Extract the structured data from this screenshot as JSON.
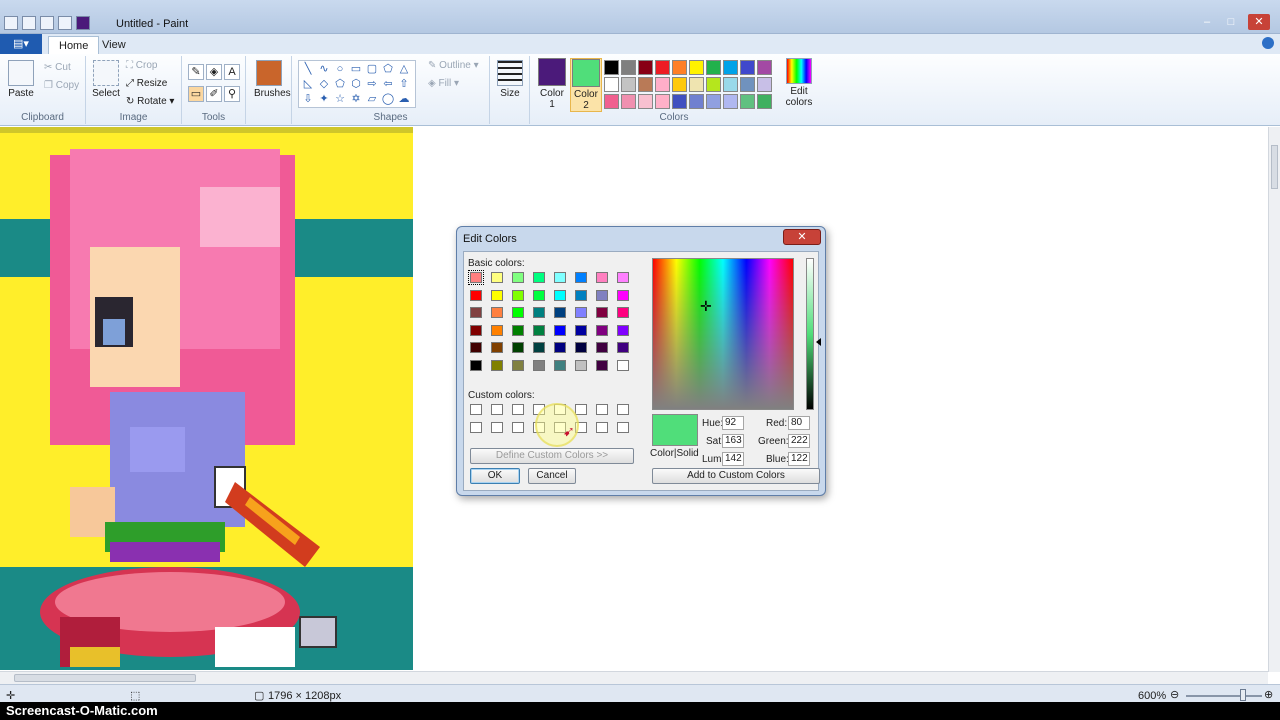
{
  "window": {
    "title": "Untitled - Paint"
  },
  "ribbon_tabs": {
    "file": "▤▾",
    "home": "Home",
    "view": "View"
  },
  "clipboard": {
    "paste": "Paste",
    "cut": "Cut",
    "copy": "Copy",
    "label": "Clipboard"
  },
  "image": {
    "select": "Select",
    "crop": "Crop",
    "resize": "Resize",
    "rotate": "Rotate",
    "label": "Image"
  },
  "tools": {
    "label": "Tools"
  },
  "brushes": {
    "label": "Brushes"
  },
  "shapes": {
    "outline": "Outline",
    "fill": "Fill",
    "label": "Shapes"
  },
  "size": {
    "label": "Size"
  },
  "colors": {
    "color1_label": "Color 1",
    "color2_label": "Color 2",
    "edit_label": "Edit colors",
    "group_label": "Colors",
    "color1": "#4b1a7a",
    "color2": "#50de7a",
    "palette": [
      "#000000",
      "#7f7f7f",
      "#880015",
      "#ed1c24",
      "#ff7f27",
      "#fff200",
      "#22b14c",
      "#00a2e8",
      "#3f48cc",
      "#a349a4",
      "#ffffff",
      "#c3c3c3",
      "#b97a57",
      "#ffaec9",
      "#ffc90e",
      "#efe4b0",
      "#b5e61d",
      "#99d9ea",
      "#7092be",
      "#c8bfe7",
      "#f06090",
      "#f090b0",
      "#f8c0d0",
      "#ffb0c8",
      "#4050c0",
      "#7080d0",
      "#90a0e0",
      "#b0b8f0",
      "#60c080",
      "#40b060"
    ]
  },
  "status": {
    "dimensions": "1796 × 1208px",
    "zoom": "600%"
  },
  "watermark": "Screencast-O-Matic.com",
  "dialog": {
    "title": "Edit Colors",
    "basic_label": "Basic colors:",
    "custom_label": "Custom colors:",
    "define_button": "Define Custom Colors >>",
    "ok_button": "OK",
    "cancel_button": "Cancel",
    "add_button": "Add to Custom Colors",
    "color_solid": "Color|Solid",
    "hue_label": "Hue:",
    "hue": "92",
    "sat_label": "Sat:",
    "sat": "163",
    "lum_label": "Lum:",
    "lum": "142",
    "red_label": "Red:",
    "red": "80",
    "green_label": "Green:",
    "green": "222",
    "blue_label": "Blue:",
    "blue": "122",
    "basic_colors": [
      "#ff8080",
      "#ffff80",
      "#80ff80",
      "#00ff80",
      "#80ffff",
      "#0080ff",
      "#ff80c0",
      "#ff80ff",
      "#ff0000",
      "#ffff00",
      "#80ff00",
      "#00ff40",
      "#00ffff",
      "#0080c0",
      "#8080c0",
      "#ff00ff",
      "#804040",
      "#ff8040",
      "#00ff00",
      "#008080",
      "#004080",
      "#8080ff",
      "#800040",
      "#ff0080",
      "#800000",
      "#ff8000",
      "#008000",
      "#008040",
      "#0000ff",
      "#0000a0",
      "#800080",
      "#8000ff",
      "#400000",
      "#804000",
      "#004000",
      "#004040",
      "#000080",
      "#000040",
      "#400040",
      "#400080",
      "#000000",
      "#808000",
      "#808040",
      "#808080",
      "#408080",
      "#c0c0c0",
      "#400040",
      "#ffffff"
    ]
  }
}
